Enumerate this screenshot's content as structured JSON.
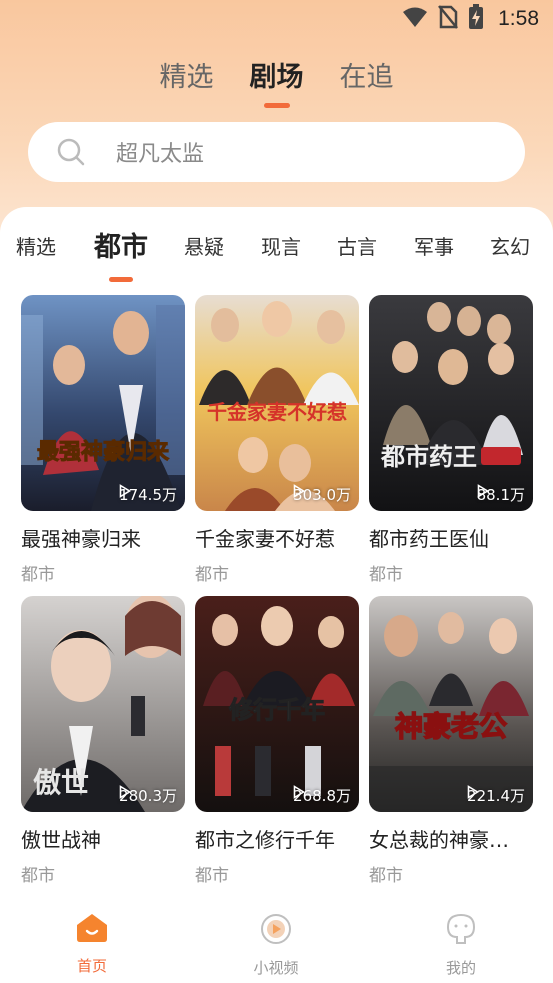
{
  "status": {
    "time": "1:58",
    "icons": [
      "wifi-icon",
      "no-sim-icon",
      "battery-charging-icon"
    ]
  },
  "top_tabs": [
    {
      "label": "精选",
      "active": false
    },
    {
      "label": "剧场",
      "active": true
    },
    {
      "label": "在追",
      "active": false
    }
  ],
  "search": {
    "placeholder": "超凡太监",
    "icon": "search-icon"
  },
  "categories": [
    {
      "label": "精选",
      "active": false
    },
    {
      "label": "都市",
      "active": true
    },
    {
      "label": "悬疑",
      "active": false
    },
    {
      "label": "现言",
      "active": false
    },
    {
      "label": "古言",
      "active": false
    },
    {
      "label": "军事",
      "active": false
    },
    {
      "label": "玄幻",
      "active": false
    }
  ],
  "dramas": [
    {
      "title": "最强神豪归来",
      "genre": "都市",
      "views": "174.5万",
      "poster_text": "最强神豪归来"
    },
    {
      "title": "千金家妻不好惹",
      "genre": "都市",
      "views": "303.0万",
      "poster_text": "千金家妻不好惹"
    },
    {
      "title": "都市药王医仙",
      "genre": "都市",
      "views": "88.1万",
      "poster_text": "都市药王"
    },
    {
      "title": "傲世战神",
      "genre": "都市",
      "views": "280.3万",
      "poster_text": "傲世"
    },
    {
      "title": "都市之修行千年",
      "genre": "都市",
      "views": "268.8万",
      "poster_text": "修行千年"
    },
    {
      "title": "女总裁的神豪…",
      "genre": "都市",
      "views": "221.4万",
      "poster_text": "神豪老公"
    }
  ],
  "bottom_nav": [
    {
      "label": "首页",
      "icon": "home-icon",
      "active": true
    },
    {
      "label": "小视频",
      "icon": "play-circle-icon",
      "active": false
    },
    {
      "label": "我的",
      "icon": "profile-icon",
      "active": false
    }
  ],
  "colors": {
    "accent": "#f26b3a",
    "header_bg": "#f9c79e"
  }
}
